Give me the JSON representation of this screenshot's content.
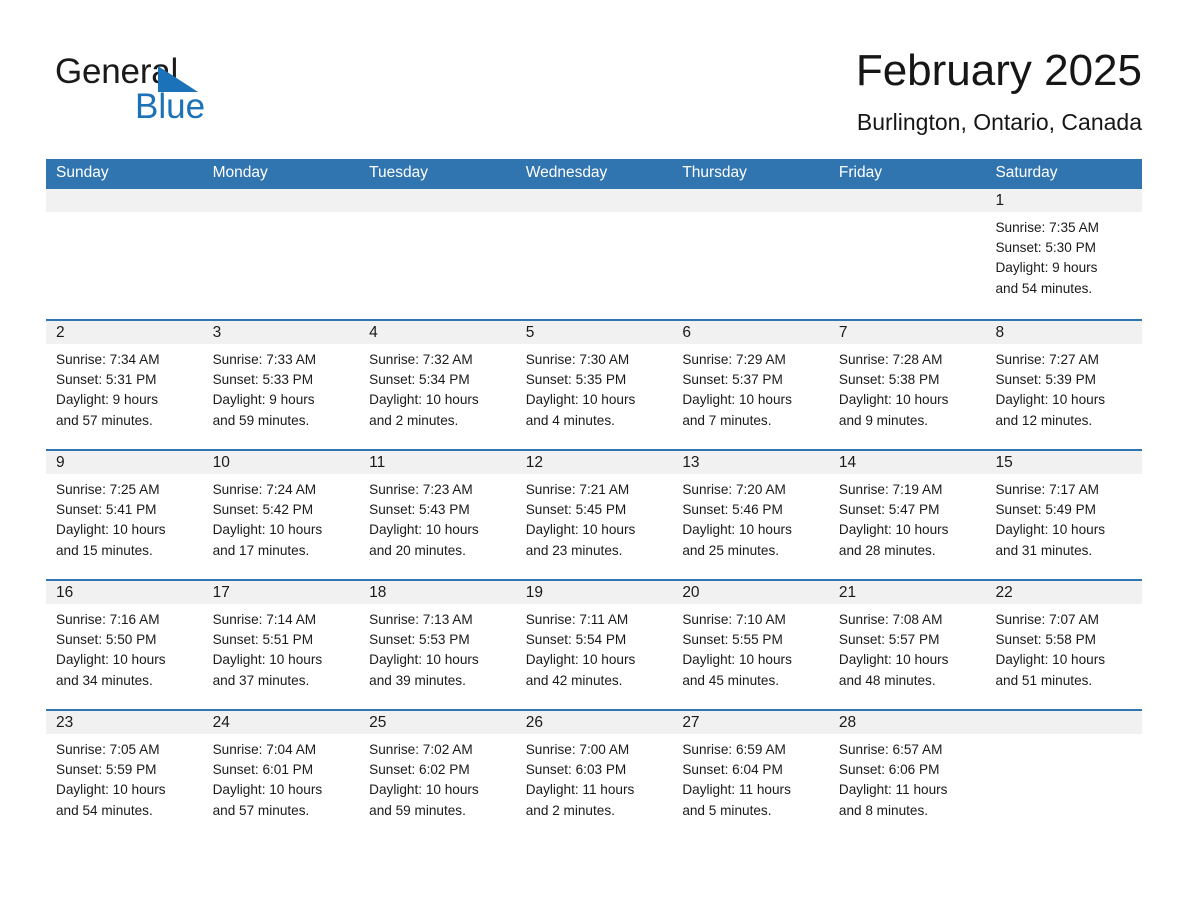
{
  "brand": {
    "line1": "General",
    "line2": "Blue",
    "triangle_color": "#1b72b8"
  },
  "header": {
    "title": "February 2025",
    "subtitle": "Burlington, Ontario, Canada"
  },
  "colors": {
    "header_blue": "#3175b0",
    "date_band": "#f1f1f1",
    "rule_blue": "#3175b0",
    "text": "#1a1a1a"
  },
  "weekday_headers": [
    "Sunday",
    "Monday",
    "Tuesday",
    "Wednesday",
    "Thursday",
    "Friday",
    "Saturday"
  ],
  "weeks": [
    [
      {
        "day": "",
        "lines": []
      },
      {
        "day": "",
        "lines": []
      },
      {
        "day": "",
        "lines": []
      },
      {
        "day": "",
        "lines": []
      },
      {
        "day": "",
        "lines": []
      },
      {
        "day": "",
        "lines": []
      },
      {
        "day": "1",
        "lines": [
          "Sunrise: 7:35 AM",
          "Sunset: 5:30 PM",
          "Daylight: 9 hours",
          "and 54 minutes."
        ]
      }
    ],
    [
      {
        "day": "2",
        "lines": [
          "Sunrise: 7:34 AM",
          "Sunset: 5:31 PM",
          "Daylight: 9 hours",
          "and 57 minutes."
        ]
      },
      {
        "day": "3",
        "lines": [
          "Sunrise: 7:33 AM",
          "Sunset: 5:33 PM",
          "Daylight: 9 hours",
          "and 59 minutes."
        ]
      },
      {
        "day": "4",
        "lines": [
          "Sunrise: 7:32 AM",
          "Sunset: 5:34 PM",
          "Daylight: 10 hours",
          "and 2 minutes."
        ]
      },
      {
        "day": "5",
        "lines": [
          "Sunrise: 7:30 AM",
          "Sunset: 5:35 PM",
          "Daylight: 10 hours",
          "and 4 minutes."
        ]
      },
      {
        "day": "6",
        "lines": [
          "Sunrise: 7:29 AM",
          "Sunset: 5:37 PM",
          "Daylight: 10 hours",
          "and 7 minutes."
        ]
      },
      {
        "day": "7",
        "lines": [
          "Sunrise: 7:28 AM",
          "Sunset: 5:38 PM",
          "Daylight: 10 hours",
          "and 9 minutes."
        ]
      },
      {
        "day": "8",
        "lines": [
          "Sunrise: 7:27 AM",
          "Sunset: 5:39 PM",
          "Daylight: 10 hours",
          "and 12 minutes."
        ]
      }
    ],
    [
      {
        "day": "9",
        "lines": [
          "Sunrise: 7:25 AM",
          "Sunset: 5:41 PM",
          "Daylight: 10 hours",
          "and 15 minutes."
        ]
      },
      {
        "day": "10",
        "lines": [
          "Sunrise: 7:24 AM",
          "Sunset: 5:42 PM",
          "Daylight: 10 hours",
          "and 17 minutes."
        ]
      },
      {
        "day": "11",
        "lines": [
          "Sunrise: 7:23 AM",
          "Sunset: 5:43 PM",
          "Daylight: 10 hours",
          "and 20 minutes."
        ]
      },
      {
        "day": "12",
        "lines": [
          "Sunrise: 7:21 AM",
          "Sunset: 5:45 PM",
          "Daylight: 10 hours",
          "and 23 minutes."
        ]
      },
      {
        "day": "13",
        "lines": [
          "Sunrise: 7:20 AM",
          "Sunset: 5:46 PM",
          "Daylight: 10 hours",
          "and 25 minutes."
        ]
      },
      {
        "day": "14",
        "lines": [
          "Sunrise: 7:19 AM",
          "Sunset: 5:47 PM",
          "Daylight: 10 hours",
          "and 28 minutes."
        ]
      },
      {
        "day": "15",
        "lines": [
          "Sunrise: 7:17 AM",
          "Sunset: 5:49 PM",
          "Daylight: 10 hours",
          "and 31 minutes."
        ]
      }
    ],
    [
      {
        "day": "16",
        "lines": [
          "Sunrise: 7:16 AM",
          "Sunset: 5:50 PM",
          "Daylight: 10 hours",
          "and 34 minutes."
        ]
      },
      {
        "day": "17",
        "lines": [
          "Sunrise: 7:14 AM",
          "Sunset: 5:51 PM",
          "Daylight: 10 hours",
          "and 37 minutes."
        ]
      },
      {
        "day": "18",
        "lines": [
          "Sunrise: 7:13 AM",
          "Sunset: 5:53 PM",
          "Daylight: 10 hours",
          "and 39 minutes."
        ]
      },
      {
        "day": "19",
        "lines": [
          "Sunrise: 7:11 AM",
          "Sunset: 5:54 PM",
          "Daylight: 10 hours",
          "and 42 minutes."
        ]
      },
      {
        "day": "20",
        "lines": [
          "Sunrise: 7:10 AM",
          "Sunset: 5:55 PM",
          "Daylight: 10 hours",
          "and 45 minutes."
        ]
      },
      {
        "day": "21",
        "lines": [
          "Sunrise: 7:08 AM",
          "Sunset: 5:57 PM",
          "Daylight: 10 hours",
          "and 48 minutes."
        ]
      },
      {
        "day": "22",
        "lines": [
          "Sunrise: 7:07 AM",
          "Sunset: 5:58 PM",
          "Daylight: 10 hours",
          "and 51 minutes."
        ]
      }
    ],
    [
      {
        "day": "23",
        "lines": [
          "Sunrise: 7:05 AM",
          "Sunset: 5:59 PM",
          "Daylight: 10 hours",
          "and 54 minutes."
        ]
      },
      {
        "day": "24",
        "lines": [
          "Sunrise: 7:04 AM",
          "Sunset: 6:01 PM",
          "Daylight: 10 hours",
          "and 57 minutes."
        ]
      },
      {
        "day": "25",
        "lines": [
          "Sunrise: 7:02 AM",
          "Sunset: 6:02 PM",
          "Daylight: 10 hours",
          "and 59 minutes."
        ]
      },
      {
        "day": "26",
        "lines": [
          "Sunrise: 7:00 AM",
          "Sunset: 6:03 PM",
          "Daylight: 11 hours",
          "and 2 minutes."
        ]
      },
      {
        "day": "27",
        "lines": [
          "Sunrise: 6:59 AM",
          "Sunset: 6:04 PM",
          "Daylight: 11 hours",
          "and 5 minutes."
        ]
      },
      {
        "day": "28",
        "lines": [
          "Sunrise: 6:57 AM",
          "Sunset: 6:06 PM",
          "Daylight: 11 hours",
          "and 8 minutes."
        ]
      },
      {
        "day": "",
        "lines": []
      }
    ]
  ]
}
